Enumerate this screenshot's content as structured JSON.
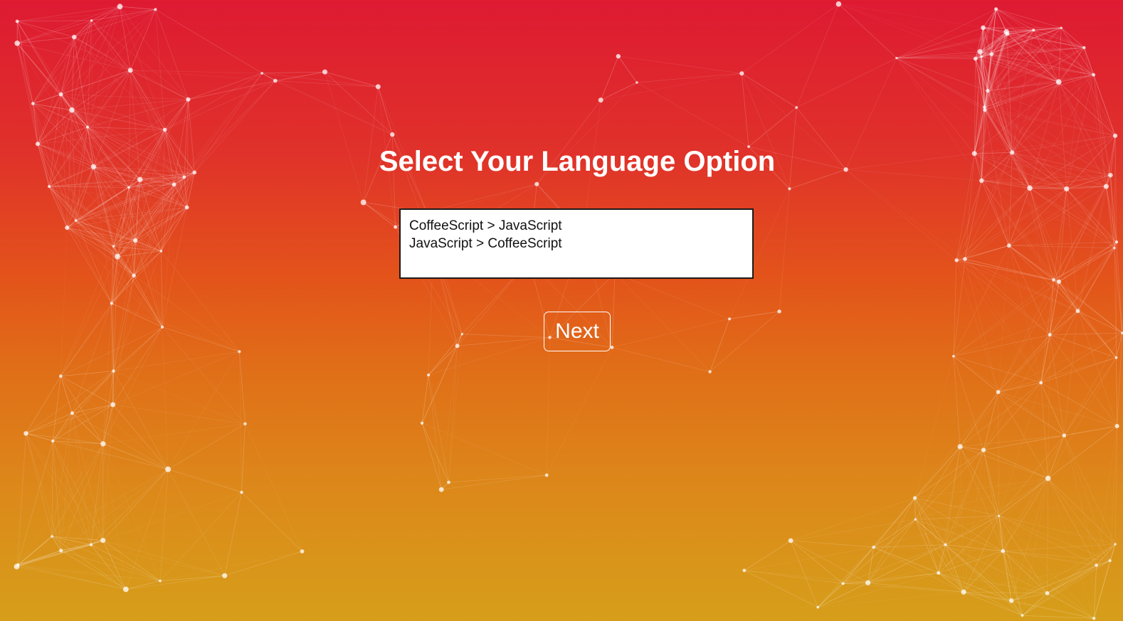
{
  "page": {
    "title": "Select Your Language Option"
  },
  "language_select": {
    "options": [
      "CoffeeScript > JavaScript",
      "JavaScript > CoffeeScript"
    ]
  },
  "actions": {
    "next_label": "Next"
  },
  "colors": {
    "gradient_top": "#de1a32",
    "gradient_middle": "#e3541a",
    "gradient_bottom": "#d69e1a",
    "network_lines": "#ffffff"
  }
}
